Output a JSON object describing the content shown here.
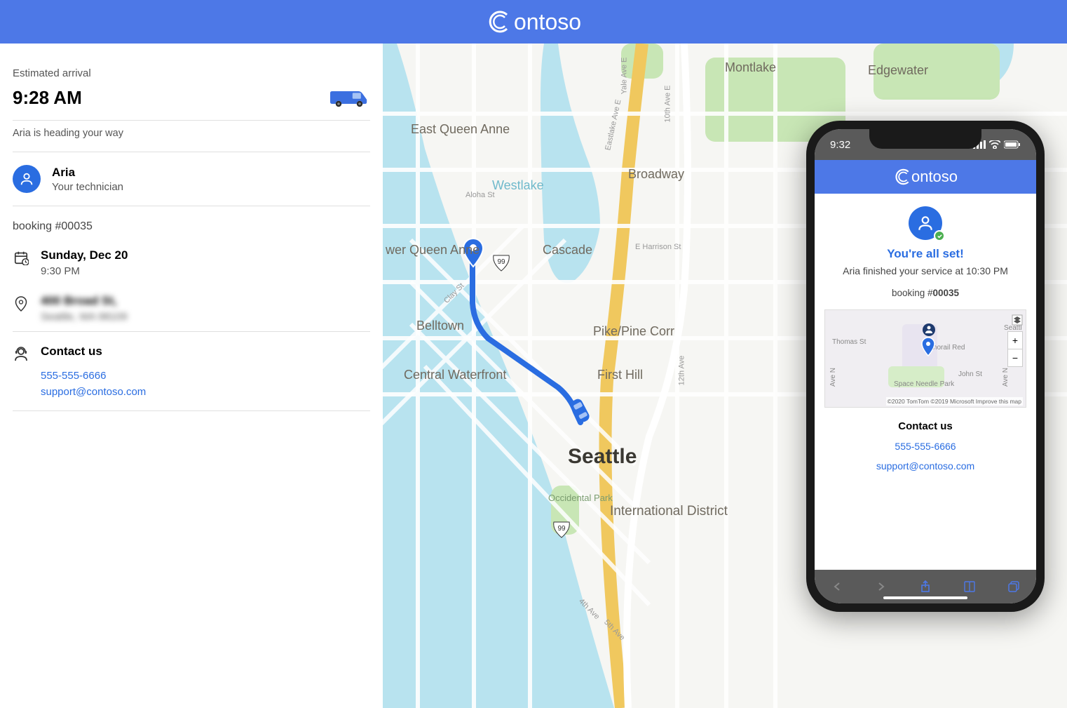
{
  "header": {
    "brand": "ontoso"
  },
  "sidebar": {
    "eta_label": "Estimated arrival",
    "eta_time": "9:28 AM",
    "status": "Aria is heading your way",
    "tech_name": "Aria",
    "tech_role": "Your technician",
    "booking": "booking #00035",
    "date": "Sunday, Dec 20",
    "time": "9:30 PM",
    "address_line1": "400 Broad St,",
    "address_line2": "Seattle, WA 98109",
    "contact_title": "Contact us",
    "phone": "555-555-6666",
    "email": "support@contoso.com"
  },
  "map": {
    "city": "Seattle",
    "labels": {
      "montlake": "Montlake",
      "edgewater": "Edgewater",
      "east_queen_anne": "East Queen Anne",
      "westlake": "Westlake",
      "broadway": "Broadway",
      "wer_queen_anne": "wer Queen Anne",
      "cascade": "Cascade",
      "e_harrison": "E Harrison St",
      "belltown": "Belltown",
      "pike_pine": "Pike/Pine Corr",
      "central_waterfront": "Central Waterfront",
      "first_hill": "First Hill",
      "occidental": "Occidental Park",
      "intl_district": "International District",
      "aloha": "Aloha St",
      "clay": "Clay St",
      "yale": "Yale Ave E",
      "eastlake": "Eastlake Ave E",
      "tenth": "10th Ave E",
      "twelfth": "12th Ave",
      "fourth": "4th Ave",
      "fifth": "5th Ave",
      "hwy99": "99"
    }
  },
  "phone": {
    "status_time": "9:32",
    "brand": "ontoso",
    "allset": "You're all set!",
    "finished": "Aria finished your service at 10:30 PM",
    "booking_prefix": "booking #",
    "booking_num": "00035",
    "map_labels": {
      "thomas": "Thomas St",
      "john": "John St",
      "space_needle": "Space Needle Park",
      "monorail": "Monorail Red",
      "seattle": "Seattl",
      "ave_n_left": "Ave N",
      "ave_n_right": "Ave N"
    },
    "zoom_plus": "+",
    "zoom_minus": "−",
    "attr": "©2020 TomTom ©2019 Microsoft  Improve this map",
    "contact_title": "Contact us",
    "phone_num": "555-555-6666",
    "email": "support@contoso.com"
  }
}
